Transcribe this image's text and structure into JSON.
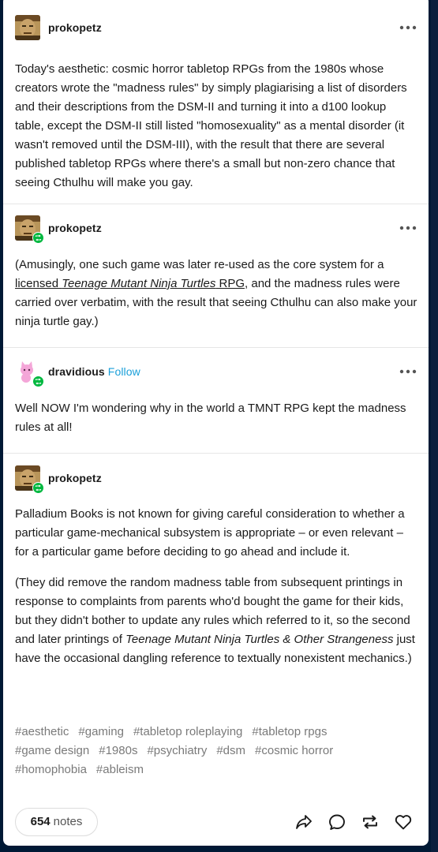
{
  "posts": [
    {
      "username": "prokopetz",
      "avatar_icon": "face-avatar-icon",
      "text": "Today's aesthetic: cosmic horror tabletop RPGs from the 1980s whose creators wrote the \"madness rules\" by simply plagiarising a list of disorders and their descriptions from the DSM-II and turning it into a d100 lookup table, except the DSM-II still listed \"homosexuality\" as a mental disorder (it wasn't removed until the DSM-III), with the result that there are several published tabletop RPGs where there's a small but non-zero chance that seeing Cthulhu will make you gay."
    },
    {
      "username": "prokopetz",
      "text_before": "(Amusingly, one such game was later re-used as the core system for a ",
      "link_plain": "licensed ",
      "link_italic": "Teenage Mutant Ninja Turtles",
      "link_tail": " RPG",
      "text_after": ", and the madness rules were carried over verbatim, with the result that seeing Cthulhu can also make your ninja turtle gay.)"
    },
    {
      "username": "dravidious",
      "follow_label": "Follow",
      "text": "Well NOW I'm wondering why in the world a TMNT RPG kept the madness rules at all!"
    },
    {
      "username": "prokopetz",
      "para1": "Palladium Books is not known for giving careful consideration to whether a particular game-mechanical subsystem is appropriate – or even relevant – for a particular game before deciding to go ahead and include it.",
      "para2_a": "(They did remove the random madness table from subsequent printings in response to complaints from parents who'd bought the game for their kids, but they didn't bother to update any rules which referred to it, so the second and later printings of ",
      "para2_italic": "Teenage Mutant Ninja Turtles & Other Strangeness",
      "para2_b": " just have the occasional dangling reference to textually nonexistent mechanics.)"
    }
  ],
  "tags": [
    "#aesthetic",
    "#gaming",
    "#tabletop roleplaying",
    "#tabletop rpgs",
    "#game design",
    "#1980s",
    "#psychiatry",
    "#dsm",
    "#cosmic horror",
    "#homophobia",
    "#ableism"
  ],
  "notes": {
    "count": "654",
    "label": "notes"
  },
  "actions": [
    "share-icon",
    "reply-icon",
    "reblog-icon",
    "like-icon"
  ],
  "colors": {
    "background": "#001935",
    "follow": "#199fd9",
    "reblog_badge": "#00b83f"
  }
}
